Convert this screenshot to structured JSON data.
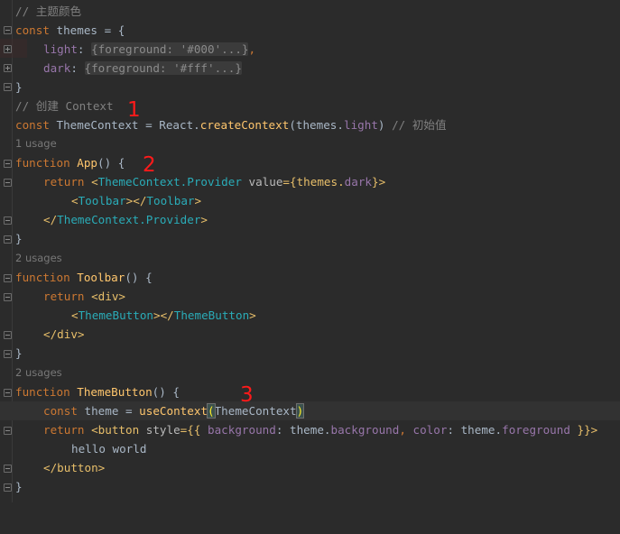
{
  "lines": {
    "l1": "// 主题颜色",
    "l2_kw": "const",
    "l2_name": " themes = {",
    "l3_prop": "light",
    "l3_colon": ": ",
    "l3_fold": "{foreground: '#000'...}",
    "l3_comma": ",",
    "l4_prop": "dark",
    "l4_colon": ": ",
    "l4_fold": "{foreground: '#fff'...}",
    "l5": "}",
    "l6": "// 创建 Context",
    "l7_kw": "const",
    "l7_a": " ThemeContext = React.",
    "l7_fn": "createContext",
    "l7_b": "(themes.",
    "l7_prop": "light",
    "l7_c": ") ",
    "l7_cmt": "// 初始值",
    "u1": "1 usage",
    "l8_kw": "function",
    "l8_fn": " App",
    "l8_b": "() {",
    "l9_kw": "return",
    "l9_tag1": " <",
    "l9_comp": "ThemeContext.Provider",
    "l9_attr": " value",
    "l9_eq": "={themes.",
    "l9_prop": "dark",
    "l9_end": "}>",
    "l10_lt": "<",
    "l10_c1": "Toolbar",
    "l10_mid": "></",
    "l10_c2": "Toolbar",
    "l10_gt": ">",
    "l11_lt": "</",
    "l11_comp": "ThemeContext.Provider",
    "l11_gt": ">",
    "l12": "}",
    "u2": "2 usages",
    "l13_kw": "function",
    "l13_fn": " Toolbar",
    "l13_b": "() {",
    "l14_kw": "return",
    "l14_tag": " <div>",
    "l15_lt": "<",
    "l15_c1": "ThemeButton",
    "l15_mid": "></",
    "l15_c2": "ThemeButton",
    "l15_gt": ">",
    "l16_tag": "</div>",
    "l17": "}",
    "u3": "2 usages",
    "l18_kw": "function",
    "l18_fn": " ThemeButton",
    "l18_b": "() {",
    "l19_kw": "const",
    "l19_a": " theme = ",
    "l19_fn": "useContext",
    "l19_p1": "(",
    "l19_arg": "ThemeContext",
    "l19_p2": ")",
    "l20_kw": "return",
    "l20_tag": " <button",
    "l20_attr": " style",
    "l20_a": "={{ ",
    "l20_p1": "background",
    "l20_b": ": theme.",
    "l20_p2": "background",
    "l20_c": ", ",
    "l20_p3": "color",
    "l20_d": ": theme.",
    "l20_p4": "foreground",
    "l20_e": " }}>",
    "l21": "hello world",
    "l22_tag": "</button>",
    "l23": "}"
  },
  "markers": {
    "m1": "1",
    "m2": "2",
    "m3": "3"
  },
  "colors": {
    "background": "#2b2b2b",
    "keyword": "#cc7832",
    "function": "#ffc66d",
    "property": "#9876aa",
    "component": "#2aacb8",
    "comment": "#808080",
    "marker": "#ff1a1a"
  }
}
